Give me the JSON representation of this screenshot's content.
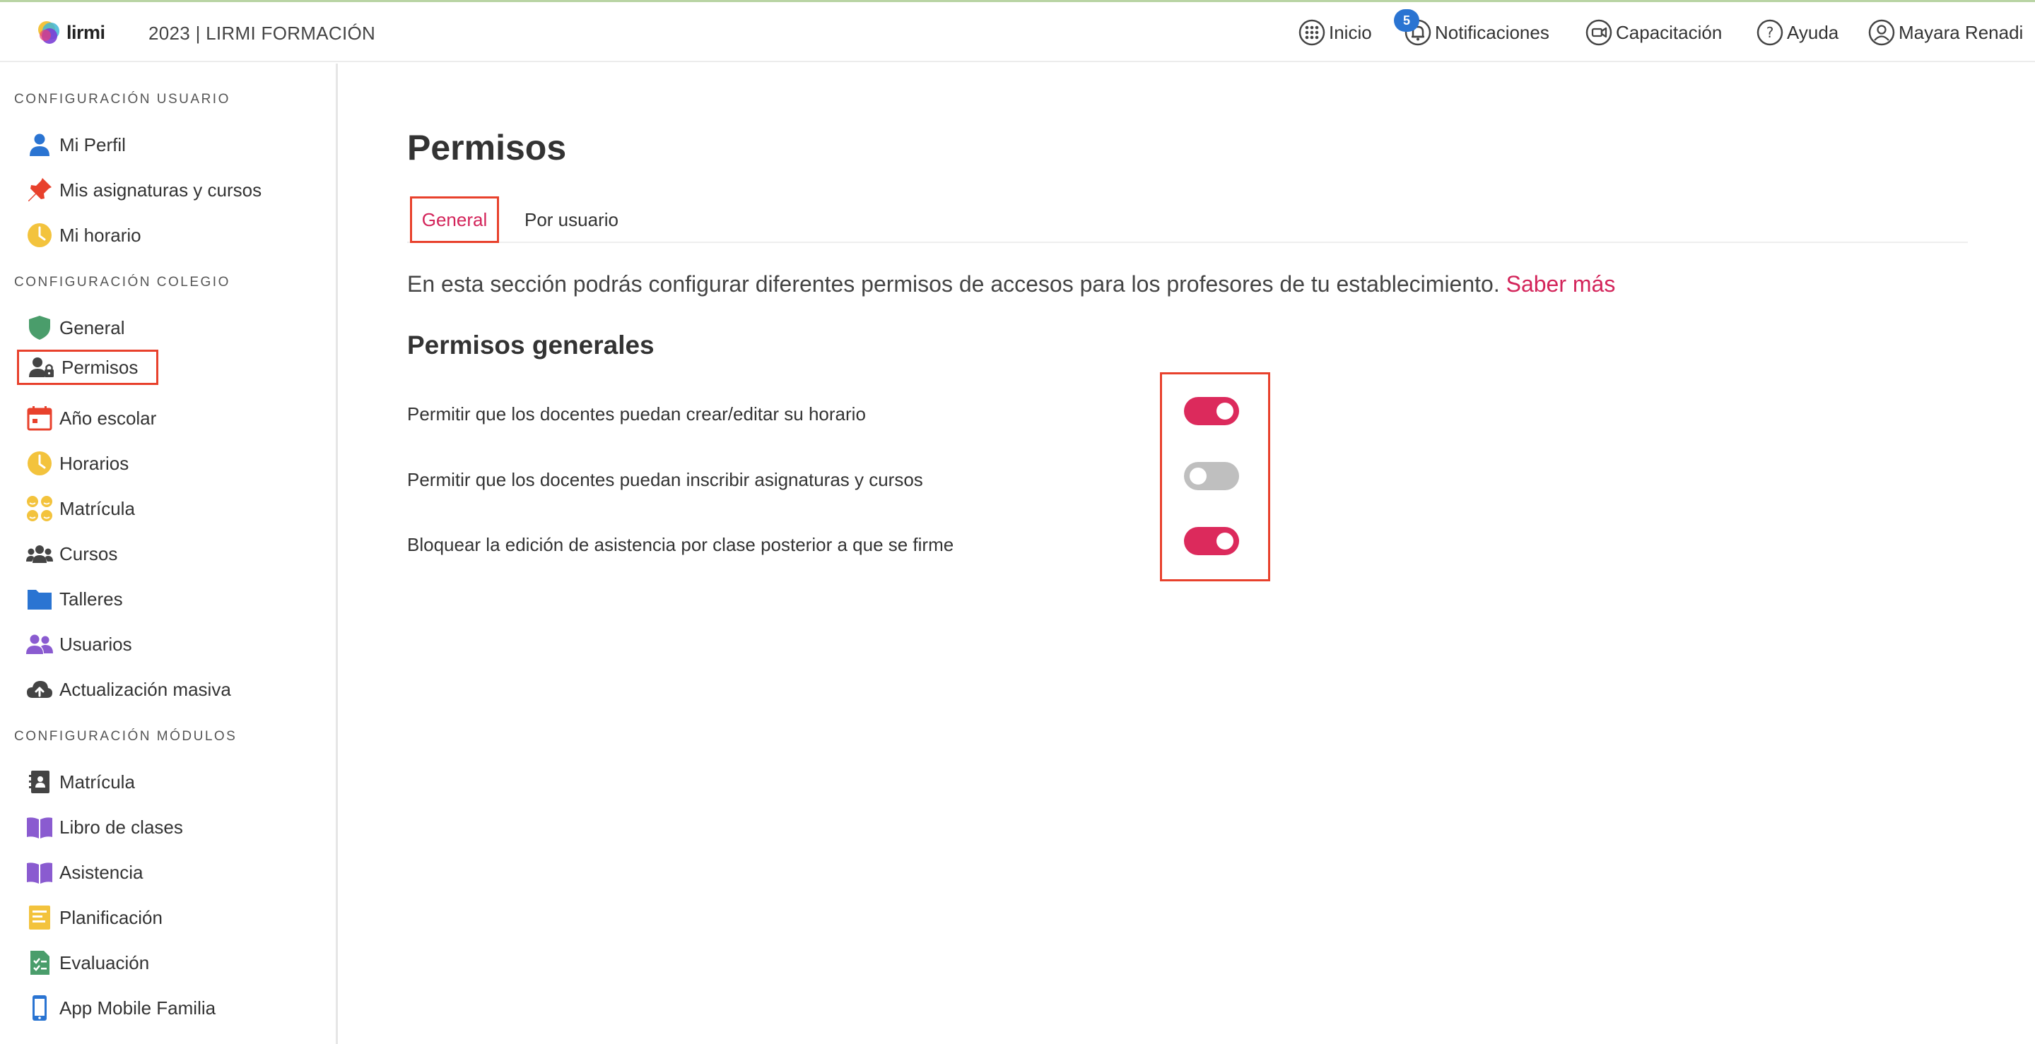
{
  "header": {
    "logo_text": "lirmi",
    "school_label": "2023  |  LIRMI FORMACIÓN",
    "nav": {
      "inicio": "Inicio",
      "notificaciones": "Notificaciones",
      "notifications_count": "5",
      "capacitacion": "Capacitación",
      "ayuda": "Ayuda",
      "user_name": "Mayara Renadi"
    }
  },
  "sidebar": {
    "section_usuario": "CONFIGURACIÓN USUARIO",
    "section_colegio": "CONFIGURACIÓN COLEGIO",
    "section_modulos": "CONFIGURACIÓN MÓDULOS",
    "usuario_items": [
      {
        "label": "Mi Perfil",
        "icon": "user-icon"
      },
      {
        "label": "Mis asignaturas y cursos",
        "icon": "pin-icon"
      },
      {
        "label": "Mi horario",
        "icon": "clock-icon"
      }
    ],
    "colegio_items": [
      {
        "label": "General",
        "icon": "shield-icon"
      },
      {
        "label": "Permisos",
        "icon": "user-lock-icon",
        "active": true
      },
      {
        "label": "Año escolar",
        "icon": "calendar-icon"
      },
      {
        "label": "Horarios",
        "icon": "clock-icon"
      },
      {
        "label": "Matrícula",
        "icon": "faces-icon"
      },
      {
        "label": "Cursos",
        "icon": "group-icon"
      },
      {
        "label": "Talleres",
        "icon": "folder-icon"
      },
      {
        "label": "Usuarios",
        "icon": "users-icon"
      },
      {
        "label": "Actualización masiva",
        "icon": "cloud-upload-icon"
      }
    ],
    "modulos_items": [
      {
        "label": "Matrícula",
        "icon": "contact-book-icon"
      },
      {
        "label": "Libro de clases",
        "icon": "book-icon"
      },
      {
        "label": "Asistencia",
        "icon": "book-icon"
      },
      {
        "label": "Planificación",
        "icon": "document-icon"
      },
      {
        "label": "Evaluación",
        "icon": "checklist-icon"
      },
      {
        "label": "App Mobile Familia",
        "icon": "phone-icon"
      }
    ]
  },
  "main": {
    "title": "Permisos",
    "tabs": [
      {
        "label": "General",
        "active": true
      },
      {
        "label": "Por usuario",
        "active": false
      }
    ],
    "intro_text": "En esta sección podrás configurar diferentes permisos de accesos para los profesores de tu establecimiento.",
    "intro_link": "Saber más",
    "subheading": "Permisos generales",
    "permissions": [
      {
        "label": "Permitir que los docentes puedan crear/editar su horario",
        "enabled": true
      },
      {
        "label": "Permitir que los docentes puedan inscribir asignaturas y cursos",
        "enabled": false
      },
      {
        "label": "Bloquear la edición de asistencia por clase posterior a que se firme",
        "enabled": true
      }
    ]
  },
  "colors": {
    "accent": "#d3245a",
    "toggle_on": "#dc2a5c",
    "toggle_off": "#bfbfbf",
    "highlight_box": "#e8412c",
    "badge": "#2a74d2"
  }
}
